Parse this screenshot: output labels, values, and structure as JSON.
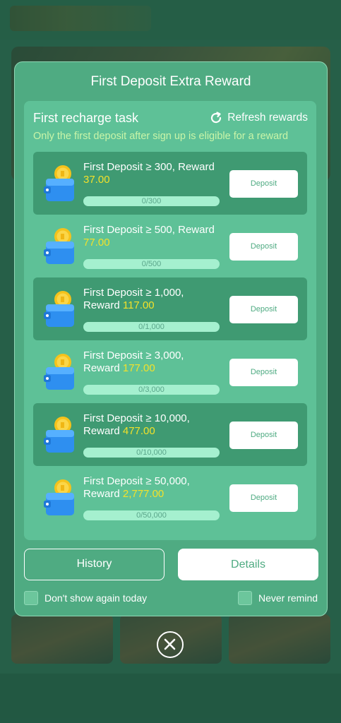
{
  "modal": {
    "title": "First Deposit Extra Reward",
    "task_heading": "First recharge task",
    "refresh_label": "Refresh rewards",
    "note": "Only the first deposit after sign up is eligible for a reward",
    "tasks": [
      {
        "line1": "First Deposit ≥ 300, Reward",
        "line2_prefix": "",
        "reward": "37.00",
        "progress_text": "0/300",
        "progress": 0,
        "button": "Deposit"
      },
      {
        "line1": "First Deposit ≥ 500, Reward",
        "line2_prefix": "",
        "reward": "77.00",
        "progress_text": "0/500",
        "progress": 0,
        "button": "Deposit"
      },
      {
        "line1": "First Deposit ≥ 1,000,",
        "line2_prefix": "Reward ",
        "reward": "117.00",
        "progress_text": "0/1,000",
        "progress": 0,
        "button": "Deposit"
      },
      {
        "line1": "First Deposit ≥ 3,000,",
        "line2_prefix": "Reward ",
        "reward": "177.00",
        "progress_text": "0/3,000",
        "progress": 0,
        "button": "Deposit"
      },
      {
        "line1": "First Deposit ≥ 10,000,",
        "line2_prefix": "Reward ",
        "reward": "477.00",
        "progress_text": "0/10,000",
        "progress": 0,
        "button": "Deposit"
      },
      {
        "line1": "First Deposit ≥ 50,000,",
        "line2_prefix": "Reward ",
        "reward": "2,777.00",
        "progress_text": "0/50,000",
        "progress": 0,
        "button": "Deposit"
      }
    ],
    "history_label": "History",
    "details_label": "Details",
    "dont_show_today": "Don't show again today",
    "never_remind": "Never remind"
  },
  "icons": {
    "refresh": "refresh-icon",
    "wallet": "wallet-coin-icon",
    "close": "close-icon"
  },
  "colors": {
    "modal_bg": "#4fab82",
    "panel_bg": "#5ec197",
    "row_dark": "#3f9a72",
    "reward_text": "#f2e12a",
    "note_text": "#c9f5a8"
  }
}
